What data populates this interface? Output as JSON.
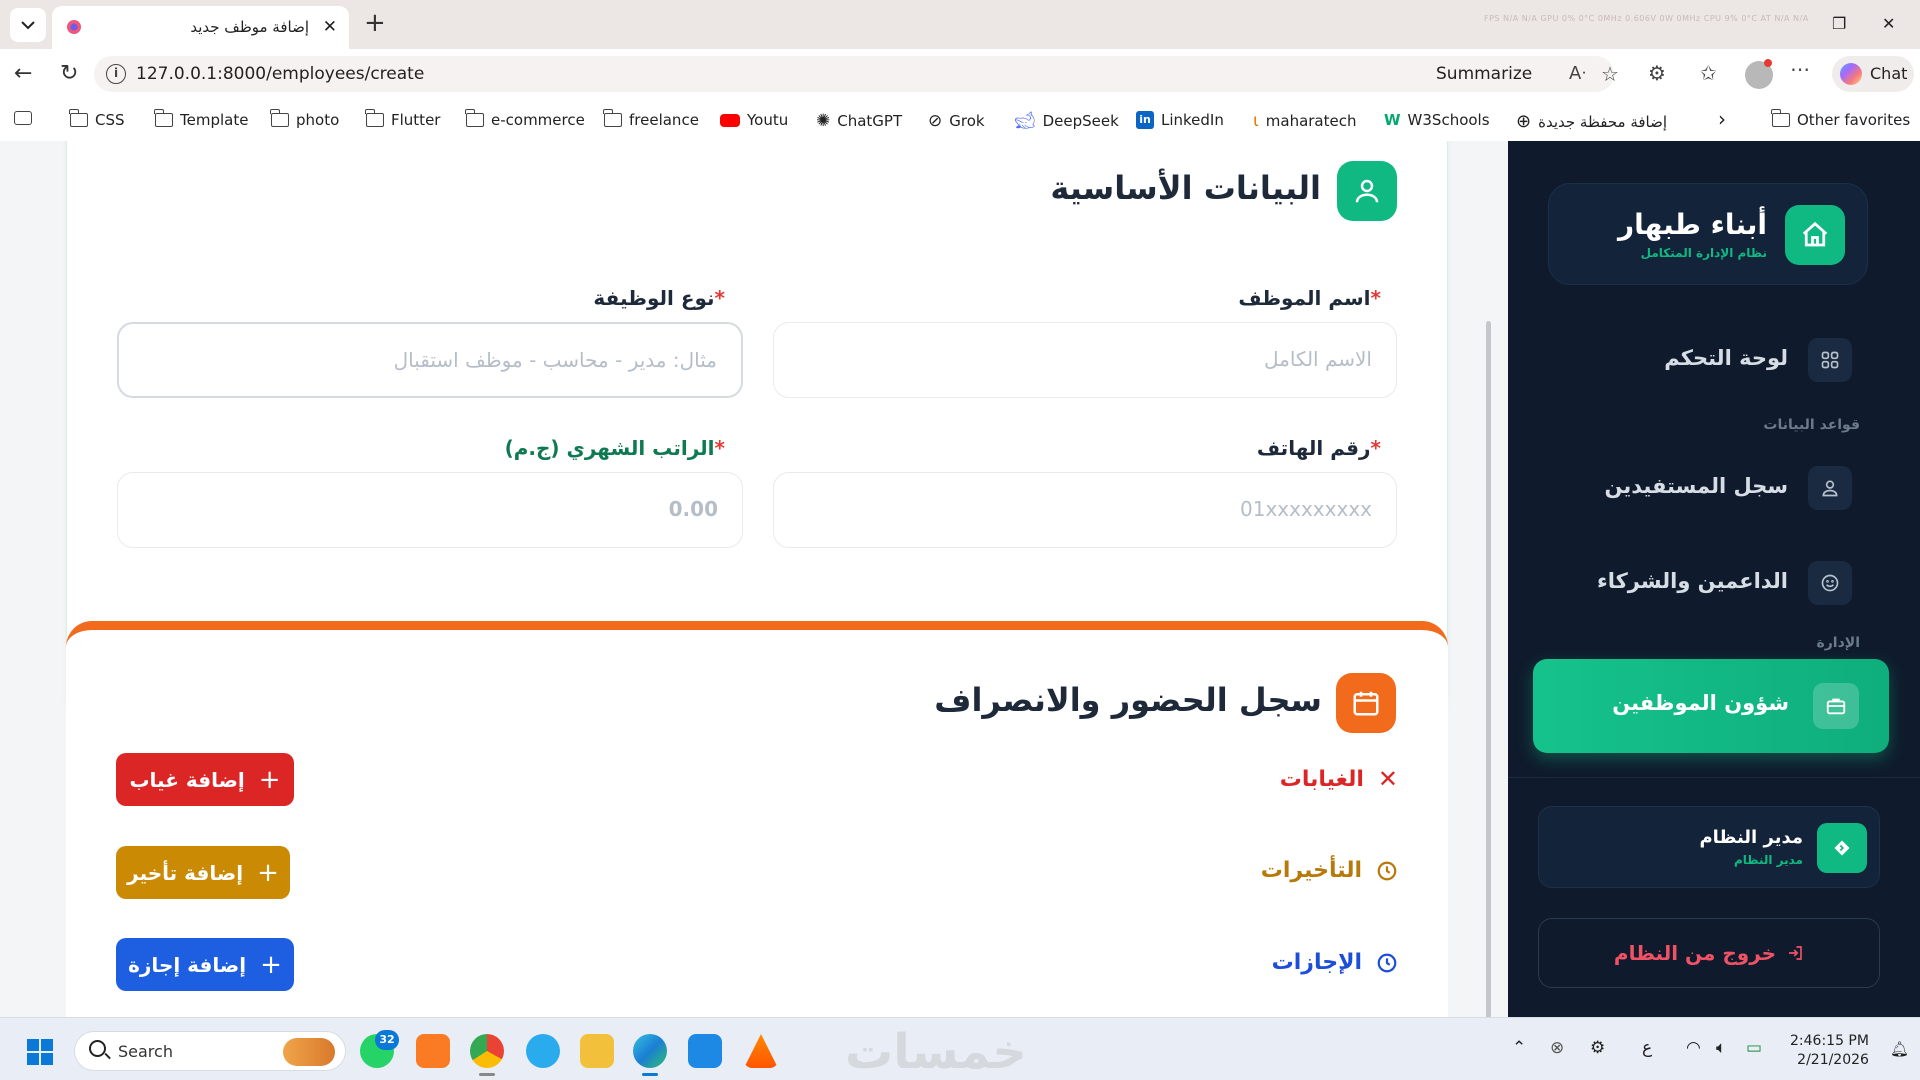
{
  "browser": {
    "tab_title": "إضافة موظف جديد",
    "url": "127.0.0.1:8000/employees/create",
    "summarize_label": "Summarize",
    "chat_label": "Chat",
    "stats_text": "FPS N/A N/A   GPU 0% 0°C 0MHz 0.606V 0W 0MHz   CPU 9% 0°C AT N/A N/A",
    "bookmarks": [
      "CSS",
      "Template",
      "photo",
      "Flutter",
      "e-commerce",
      "freelance",
      "Youtu",
      "ChatGPT",
      "Grok",
      "DeepSeek",
      "LinkedIn",
      "maharatech",
      "W3Schools",
      "إضافة محفظة جديدة",
      "Other favorites"
    ]
  },
  "basic_info": {
    "title": "البيانات الأساسية",
    "name_label": "اسم الموظف",
    "name_placeholder": "الاسم الكامل",
    "job_label": "نوع الوظيفة",
    "job_placeholder": "مثال: مدير - محاسب - موظف استقبال",
    "phone_label": "رقم الهاتف",
    "phone_placeholder": "01xxxxxxxxx",
    "salary_label": "الراتب الشهري (ج.م)",
    "salary_placeholder": "0.00",
    "required_mark": "*"
  },
  "attendance": {
    "title": "سجل الحضور والانصراف",
    "absences_label": "الغيابات",
    "delays_label": "التأخيرات",
    "leaves_label": "الإجازات",
    "add_absence": "إضافة غياب",
    "add_delay": "إضافة تأخير",
    "add_leave": "إضافة إجازة"
  },
  "sidebar": {
    "brand_title": "أبناء طبهار",
    "brand_subtitle": "نظام الإدارة المتكامل",
    "dashboard": "لوحة التحكم",
    "section_data": "قواعد البيانات",
    "beneficiaries": "سجل المستفيدين",
    "supporters": "الداعمين والشركاء",
    "section_admin": "الإدارة",
    "employees": "شؤون الموظفين",
    "admin_name": "مدير النظام",
    "admin_role": "مدير النظام",
    "logout": "خروج من النظام"
  },
  "taskbar": {
    "search_label": "Search",
    "whatsapp_badge": "32",
    "watermark": "خمسات",
    "lang": "ع",
    "time": "2:46:15 PM",
    "date": "2/21/2026"
  },
  "colors": {
    "accent_green": "#10b981",
    "accent_orange": "#f26b1d",
    "absence_red": "#dc2626",
    "delay_gold": "#ca8a04",
    "leave_blue": "#1d4ed8",
    "sidebar_bg": "#0f1b2c"
  }
}
